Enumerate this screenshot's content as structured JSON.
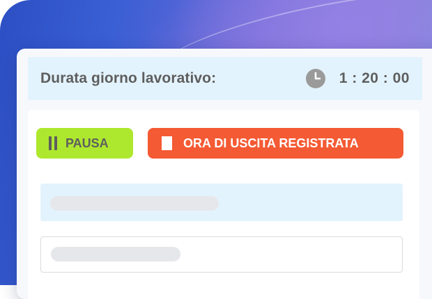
{
  "header": {
    "title": "Durata giorno lavorativo:",
    "clock_icon": "clock-icon",
    "timer": "1 : 20 : 00"
  },
  "actions": {
    "pause_label": "PAUSA",
    "pause_icon": "pause-icon",
    "exit_label": "ORA DI USCITA REGISTRATA",
    "exit_icon": "stop-icon"
  },
  "colors": {
    "header_bg": "#e3f3fd",
    "pause_bg": "#aee82e",
    "exit_bg": "#f45a33",
    "text_gray": "#5e5e5e",
    "background_gradient_start": "#2c4fc4",
    "background_gradient_end": "#8b7fd8"
  }
}
